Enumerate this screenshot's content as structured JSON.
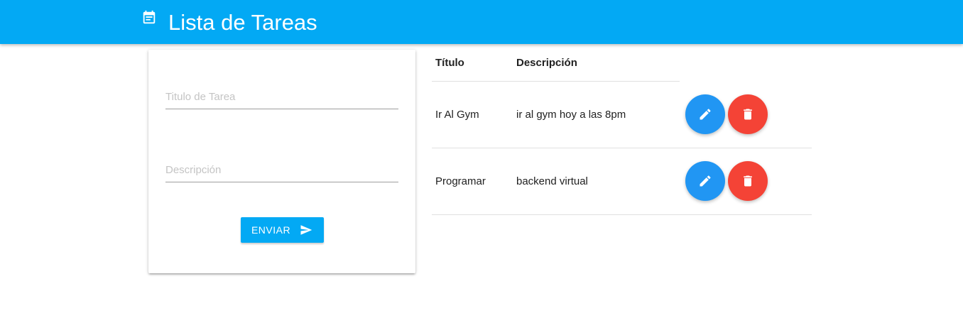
{
  "app": {
    "title": "Lista de Tareas",
    "icon": "calendar-icon",
    "accent_color": "#03a9f4"
  },
  "form": {
    "title_placeholder": "Titulo de Tarea",
    "title_value": "",
    "description_placeholder": "Descripción",
    "description_value": "",
    "submit_label": "ENVIAR",
    "submit_icon": "send-icon"
  },
  "table": {
    "headers": {
      "title": "Título",
      "description": "Descripción"
    },
    "rows": [
      {
        "title": "Ir Al Gym",
        "description": "ir al gym hoy a las 8pm",
        "edit_icon": "pencil-icon",
        "delete_icon": "trash-icon"
      },
      {
        "title": "Programar",
        "description": "backend virtual",
        "edit_icon": "pencil-icon",
        "delete_icon": "trash-icon"
      }
    ],
    "edit_color": "#2196f3",
    "delete_color": "#f44336"
  }
}
